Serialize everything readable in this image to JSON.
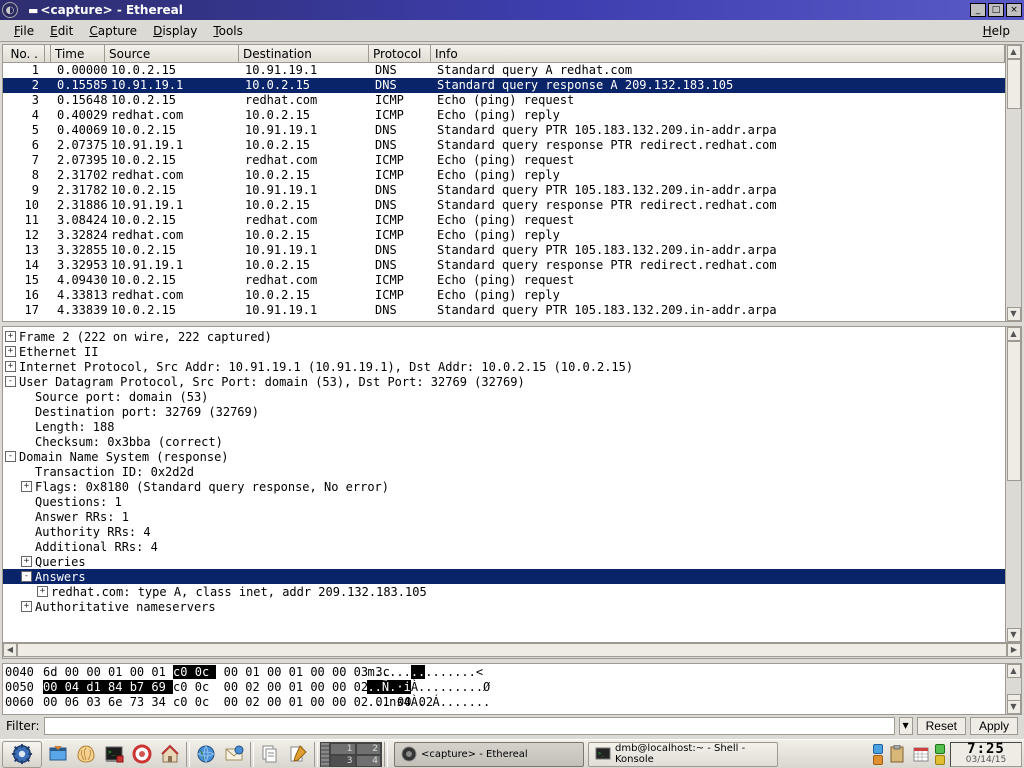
{
  "window": {
    "title": "<capture> - Ethereal",
    "min": "_",
    "max": "□",
    "close": "×"
  },
  "menu": {
    "file": "File",
    "edit": "Edit",
    "capture": "Capture",
    "display": "Display",
    "tools": "Tools",
    "help": "Help"
  },
  "packet_columns": {
    "no": "No. .",
    "time": "Time",
    "source": "Source",
    "destination": "Destination",
    "protocol": "Protocol",
    "info": "Info"
  },
  "packets": [
    {
      "no": "1",
      "time": "0.000000",
      "src": "10.0.2.15",
      "dst": "10.91.19.1",
      "proto": "DNS",
      "info": "Standard query A redhat.com",
      "sel": false
    },
    {
      "no": "2",
      "time": "0.155855",
      "src": "10.91.19.1",
      "dst": "10.0.2.15",
      "proto": "DNS",
      "info": "Standard query response A 209.132.183.105",
      "sel": true
    },
    {
      "no": "3",
      "time": "0.156484",
      "src": "10.0.2.15",
      "dst": "redhat.com",
      "proto": "ICMP",
      "info": "Echo (ping) request",
      "sel": false
    },
    {
      "no": "4",
      "time": "0.400293",
      "src": "redhat.com",
      "dst": "10.0.2.15",
      "proto": "ICMP",
      "info": "Echo (ping) reply",
      "sel": false
    },
    {
      "no": "5",
      "time": "0.400698",
      "src": "10.0.2.15",
      "dst": "10.91.19.1",
      "proto": "DNS",
      "info": "Standard query PTR 105.183.132.209.in-addr.arpa",
      "sel": false
    },
    {
      "no": "6",
      "time": "2.073751",
      "src": "10.91.19.1",
      "dst": "10.0.2.15",
      "proto": "DNS",
      "info": "Standard query response PTR redirect.redhat.com",
      "sel": false
    },
    {
      "no": "7",
      "time": "2.073957",
      "src": "10.0.2.15",
      "dst": "redhat.com",
      "proto": "ICMP",
      "info": "Echo (ping) request",
      "sel": false
    },
    {
      "no": "8",
      "time": "2.317025",
      "src": "redhat.com",
      "dst": "10.0.2.15",
      "proto": "ICMP",
      "info": "Echo (ping) reply",
      "sel": false
    },
    {
      "no": "9",
      "time": "2.317821",
      "src": "10.0.2.15",
      "dst": "10.91.19.1",
      "proto": "DNS",
      "info": "Standard query PTR 105.183.132.209.in-addr.arpa",
      "sel": false
    },
    {
      "no": "10",
      "time": "2.318866",
      "src": "10.91.19.1",
      "dst": "10.0.2.15",
      "proto": "DNS",
      "info": "Standard query response PTR redirect.redhat.com",
      "sel": false
    },
    {
      "no": "11",
      "time": "3.084244",
      "src": "10.0.2.15",
      "dst": "redhat.com",
      "proto": "ICMP",
      "info": "Echo (ping) request",
      "sel": false
    },
    {
      "no": "12",
      "time": "3.328246",
      "src": "redhat.com",
      "dst": "10.0.2.15",
      "proto": "ICMP",
      "info": "Echo (ping) reply",
      "sel": false
    },
    {
      "no": "13",
      "time": "3.328551",
      "src": "10.0.2.15",
      "dst": "10.91.19.1",
      "proto": "DNS",
      "info": "Standard query PTR 105.183.132.209.in-addr.arpa",
      "sel": false
    },
    {
      "no": "14",
      "time": "3.329539",
      "src": "10.91.19.1",
      "dst": "10.0.2.15",
      "proto": "DNS",
      "info": "Standard query response PTR redirect.redhat.com",
      "sel": false
    },
    {
      "no": "15",
      "time": "4.094307",
      "src": "10.0.2.15",
      "dst": "redhat.com",
      "proto": "ICMP",
      "info": "Echo (ping) request",
      "sel": false
    },
    {
      "no": "16",
      "time": "4.338132",
      "src": "redhat.com",
      "dst": "10.0.2.15",
      "proto": "ICMP",
      "info": "Echo (ping) reply",
      "sel": false
    },
    {
      "no": "17",
      "time": "4.338395",
      "src": "10.0.2.15",
      "dst": "10.91.19.1",
      "proto": "DNS",
      "info": "Standard query PTR 105.183.132.209.in-addr.arpa",
      "sel": false
    }
  ],
  "tree": [
    {
      "indent": 0,
      "twist": "+",
      "text": "Frame 2 (222 on wire, 222 captured)",
      "sel": false
    },
    {
      "indent": 0,
      "twist": "+",
      "text": "Ethernet II",
      "sel": false
    },
    {
      "indent": 0,
      "twist": "+",
      "text": "Internet Protocol, Src Addr: 10.91.19.1 (10.91.19.1), Dst Addr: 10.0.2.15 (10.0.2.15)",
      "sel": false
    },
    {
      "indent": 0,
      "twist": "-",
      "text": "User Datagram Protocol, Src Port: domain (53), Dst Port: 32769 (32769)",
      "sel": false
    },
    {
      "indent": 1,
      "twist": "",
      "text": "Source port: domain (53)",
      "sel": false
    },
    {
      "indent": 1,
      "twist": "",
      "text": "Destination port: 32769 (32769)",
      "sel": false
    },
    {
      "indent": 1,
      "twist": "",
      "text": "Length: 188",
      "sel": false
    },
    {
      "indent": 1,
      "twist": "",
      "text": "Checksum: 0x3bba (correct)",
      "sel": false
    },
    {
      "indent": 0,
      "twist": "-",
      "text": "Domain Name System (response)",
      "sel": false
    },
    {
      "indent": 1,
      "twist": "",
      "text": "Transaction ID: 0x2d2d",
      "sel": false
    },
    {
      "indent": 1,
      "twist": "+",
      "text": "Flags: 0x8180 (Standard query response, No error)",
      "sel": false
    },
    {
      "indent": 1,
      "twist": "",
      "text": "Questions: 1",
      "sel": false
    },
    {
      "indent": 1,
      "twist": "",
      "text": "Answer RRs: 1",
      "sel": false
    },
    {
      "indent": 1,
      "twist": "",
      "text": "Authority RRs: 4",
      "sel": false
    },
    {
      "indent": 1,
      "twist": "",
      "text": "Additional RRs: 4",
      "sel": false
    },
    {
      "indent": 1,
      "twist": "+",
      "text": "Queries",
      "sel": false
    },
    {
      "indent": 1,
      "twist": "-",
      "text": "Answers",
      "sel": true
    },
    {
      "indent": 2,
      "twist": "+",
      "text": "redhat.com: type A, class inet, addr 209.132.183.105",
      "sel": false
    },
    {
      "indent": 1,
      "twist": "+",
      "text": "Authoritative nameservers",
      "sel": false
    }
  ],
  "hex": [
    {
      "off": "0040",
      "b1": "6d 00 00 01 00 01 ",
      "b2": "c0 0c ",
      "b3": " 00 01 00 01 00 00 03 3c",
      "a1": "m.....",
      "a2": "..",
      "a3": ".......<"
    },
    {
      "off": "0050",
      "b1": "",
      "b2": "00 04 d1 84 b7 69 ",
      "b3": "c0 0c  00 02 00 01 00 00 02 80 d8",
      "a1": "",
      "a2": "..Ñ.·i",
      "a3": "À.........Ø"
    },
    {
      "off": "0060",
      "b1": "00 06 03 6e 73 34 c0 0c  00 02 00 01 00 00 02 01 00 02",
      "b2": "",
      "b3": "",
      "a1": "...ns4À. Á.......",
      "a2": "",
      "a3": ""
    }
  ],
  "filter": {
    "label": "Filter:",
    "value": "",
    "reset": "Reset",
    "apply": "Apply"
  },
  "taskbar": {
    "pager": {
      "cells": [
        "1",
        "2",
        "3",
        "4"
      ],
      "active_index": 2
    },
    "tasks": [
      {
        "line1": "<capture> - Ethereal",
        "line2": "",
        "active": true,
        "icon": "ethereal"
      },
      {
        "line1": "dmb@localhost:~ - Shell - Konsole",
        "line2": "",
        "active": false,
        "icon": "konsole"
      }
    ],
    "clock": {
      "time": "7:25",
      "date": "03/14/15"
    }
  }
}
